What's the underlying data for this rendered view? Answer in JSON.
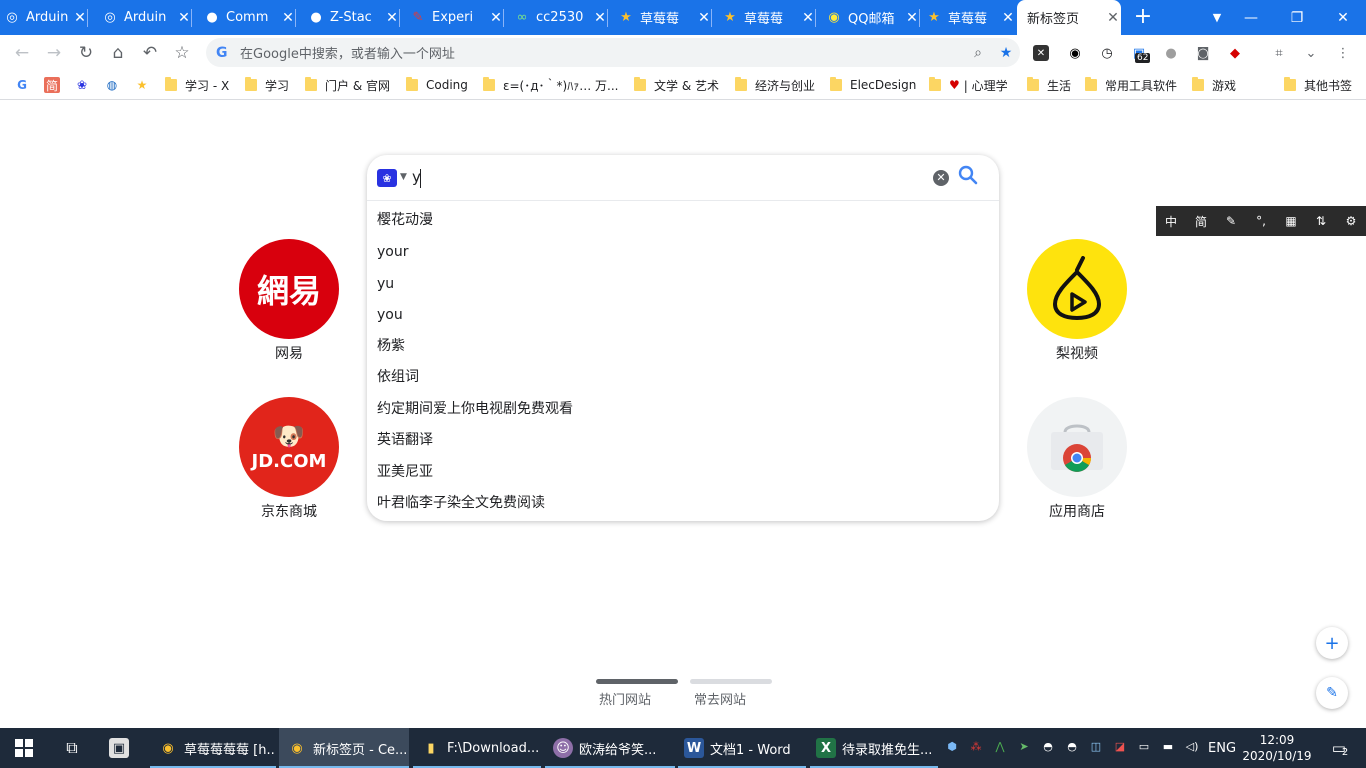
{
  "tabs": [
    {
      "title": "Arduin",
      "icon": "arduino-icon"
    },
    {
      "title": "Arduin",
      "icon": "arduino-icon"
    },
    {
      "title": "Comm",
      "icon": "github-icon"
    },
    {
      "title": "Z-Stac",
      "icon": "github-icon"
    },
    {
      "title": "Experi",
      "icon": "brush-icon"
    },
    {
      "title": "cc2530",
      "icon": "infinity-icon"
    },
    {
      "title": "草莓莓",
      "icon": "star-icon"
    },
    {
      "title": "草莓莓",
      "icon": "star-icon"
    },
    {
      "title": "QQ邮箱",
      "icon": "chrome-icon"
    },
    {
      "title": "草莓莓",
      "icon": "star-icon"
    },
    {
      "title": "新标签页",
      "icon": ""
    }
  ],
  "omnibox": {
    "placeholder": "在Google中搜索，或者输入一个网址"
  },
  "extension_badge": "62",
  "bookmarks": [
    {
      "label": "学习 - X"
    },
    {
      "label": "学习"
    },
    {
      "label": "门户 & 官网"
    },
    {
      "label": "Coding"
    },
    {
      "label": "ε=(･д･｀*)ﾊｧ… 万..."
    },
    {
      "label": "文学 & 艺术"
    },
    {
      "label": "经济与创业"
    },
    {
      "label": "ElecDesign"
    },
    {
      "label": "| 心理学"
    },
    {
      "label": "生活"
    },
    {
      "label": "常用工具软件"
    },
    {
      "label": "游戏"
    },
    {
      "label": "其他书签"
    }
  ],
  "bookmark_icons": {
    "simple": "简"
  },
  "tiles": {
    "netease": {
      "label": "网易",
      "logo": "網易"
    },
    "jd": {
      "label": "京东商城",
      "logo": "JD.COM"
    },
    "pear": {
      "label": "梨视频"
    },
    "store": {
      "label": "应用商店"
    }
  },
  "search": {
    "query": "y",
    "suggestions": [
      "樱花动漫",
      "your",
      "yu",
      "you",
      "杨紫",
      "依组词",
      "约定期间爱上你电视剧免费观看",
      "英语翻译",
      "亚美尼亚",
      "叶君临李子染全文免费阅读"
    ]
  },
  "ime_toolbar": {
    "lang": "中",
    "simp": "简"
  },
  "bottom_tabs": {
    "hot": "热门网站",
    "frequent": "常去网站"
  },
  "taskbar": {
    "items": [
      {
        "label": "草莓莓莓莓 [h..."
      },
      {
        "label": "新标签页 - Ce..."
      },
      {
        "label": "F:\\Download..."
      },
      {
        "label": "欧涛给爷笑..."
      },
      {
        "label": "文档1 - Word"
      },
      {
        "label": "待录取推免生..."
      }
    ],
    "lang": "ENG",
    "time": "12:09",
    "date": "2020/10/19",
    "notifications": "2"
  }
}
